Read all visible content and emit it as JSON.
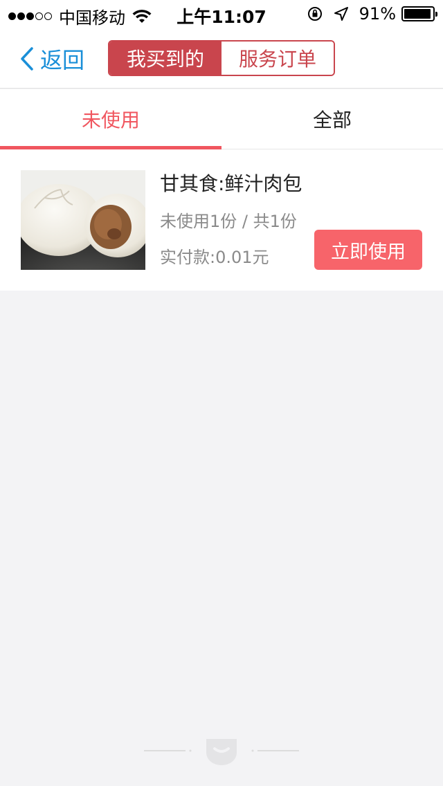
{
  "status_bar": {
    "carrier": "中国移动",
    "time": "上午11:07",
    "battery": "91%",
    "signal_filled": 3,
    "signal_total": 5,
    "battery_level": 0.91
  },
  "nav": {
    "back_label": "返回",
    "segments": [
      {
        "label": "我买到的",
        "active": true
      },
      {
        "label": "服务订单",
        "active": false
      }
    ]
  },
  "tabs": [
    {
      "label": "未使用",
      "active": true
    },
    {
      "label": "全部",
      "active": false
    }
  ],
  "order": {
    "title": "甘其食:鲜汁肉包",
    "quantity": "未使用1份 / 共1份",
    "paid": "实付款:0.01元",
    "action_label": "立即使用",
    "image": "steamed-bun-photo"
  },
  "colors": {
    "accent": "#f0565f",
    "segment_red": "#c9454d",
    "link_blue": "#1a8fd8",
    "button_red": "#f7646a",
    "page_bg": "#f3f3f5"
  }
}
